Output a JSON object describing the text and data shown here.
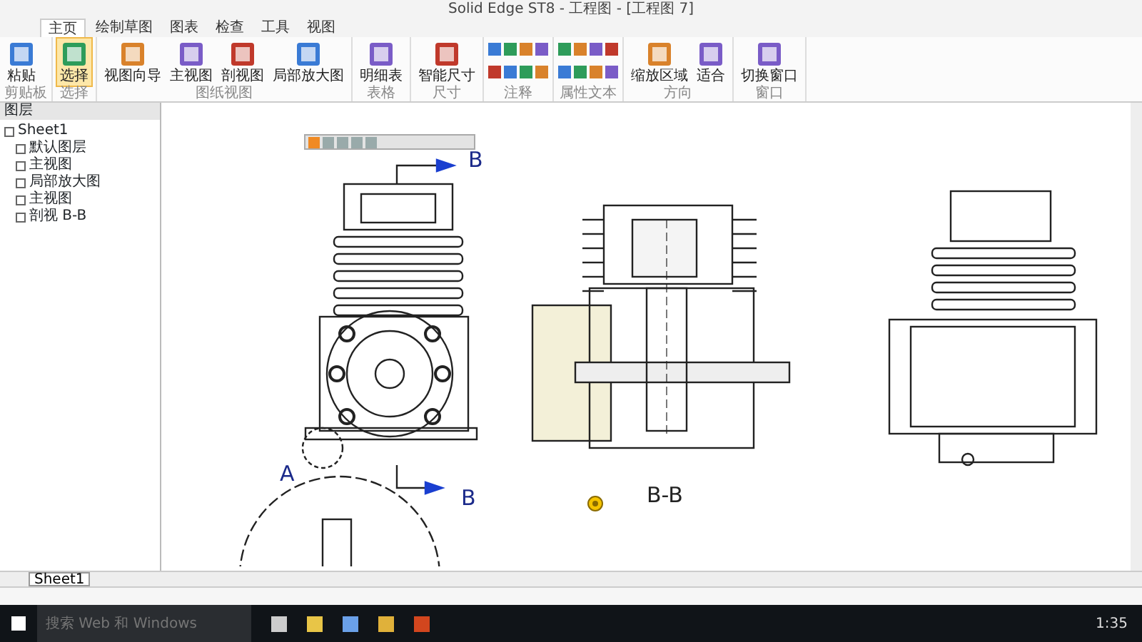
{
  "window": {
    "title": "Solid Edge ST8 - 工程图 - [工程图 7]"
  },
  "tabs": [
    {
      "label": "主页",
      "selected": true
    },
    {
      "label": "绘制草图",
      "selected": false
    },
    {
      "label": "图表",
      "selected": false
    },
    {
      "label": "检查",
      "selected": false
    },
    {
      "label": "工具",
      "selected": false
    },
    {
      "label": "视图",
      "selected": false
    }
  ],
  "ribbon_groups": [
    {
      "label": "剪贴板",
      "buttons": [
        {
          "label": "粘贴",
          "selected": false
        }
      ]
    },
    {
      "label": "选择",
      "buttons": [
        {
          "label": "选择",
          "selected": true
        }
      ]
    },
    {
      "label": "图纸视图",
      "buttons": [
        {
          "label": "视图向导",
          "selected": false
        },
        {
          "label": "主视图",
          "selected": false
        },
        {
          "label": "剖视图",
          "selected": false
        },
        {
          "label": "局部放大图",
          "selected": false
        }
      ]
    },
    {
      "label": "表格",
      "buttons": [
        {
          "label": "明细表",
          "selected": false
        }
      ]
    },
    {
      "label": "尺寸",
      "buttons": [
        {
          "label": "智能尺寸",
          "selected": false
        }
      ]
    },
    {
      "label": "注释"
    },
    {
      "label": "属性文本"
    },
    {
      "label": "方向",
      "buttons": [
        {
          "label": "缩放区域",
          "selected": false
        },
        {
          "label": "适合",
          "selected": false
        }
      ]
    },
    {
      "label": "窗口",
      "buttons": [
        {
          "label": "切换窗口",
          "selected": false
        }
      ]
    }
  ],
  "sidebar": {
    "title": "图层",
    "tree": [
      {
        "label": "Sheet1",
        "children": [
          {
            "label": "默认图层"
          },
          {
            "label": "主视图"
          },
          {
            "label": "局部放大图"
          },
          {
            "label": "主视图"
          },
          {
            "label": "剖视 B-B"
          }
        ]
      }
    ]
  },
  "canvas": {
    "labels": [
      {
        "kind": "section",
        "text": "B"
      },
      {
        "kind": "detail",
        "text": "A"
      },
      {
        "kind": "section",
        "text": "B"
      },
      {
        "kind": "view",
        "text": "B-B"
      }
    ]
  },
  "sheet_tabs": [
    {
      "label": "Sheet1",
      "selected": true
    }
  ],
  "taskbar": {
    "search_placeholder": "搜索 Web 和 Windows",
    "time": "1:35"
  }
}
